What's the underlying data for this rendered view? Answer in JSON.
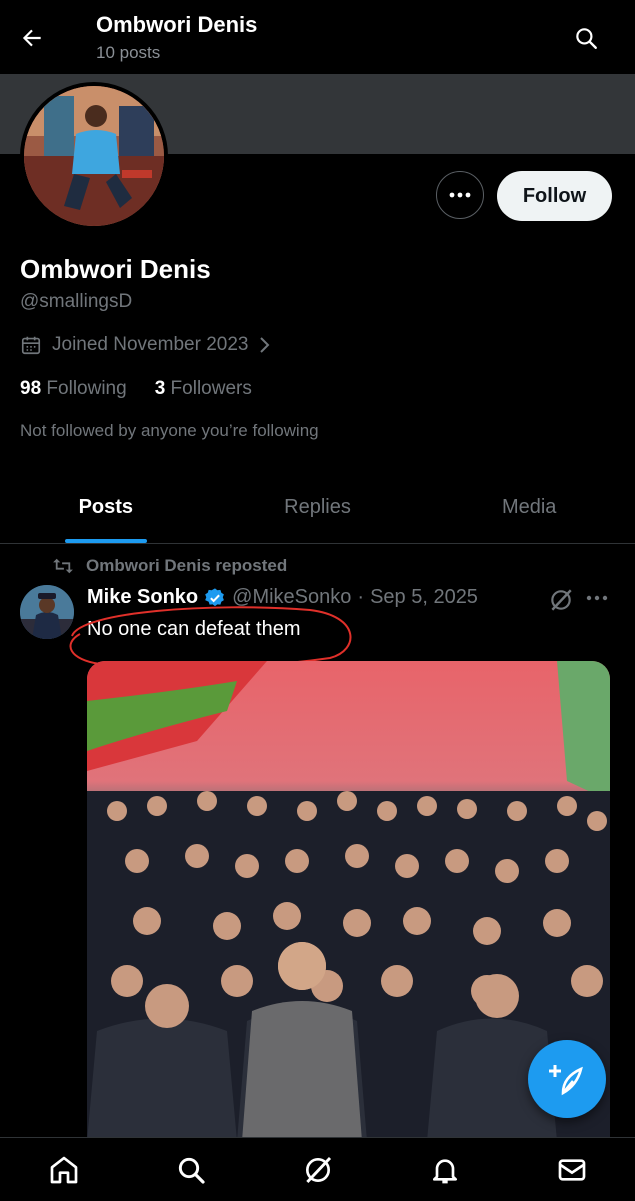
{
  "header": {
    "title": "Ombwori Denis",
    "subtitle": "10 posts"
  },
  "profile": {
    "name": "Ombwori Denis",
    "handle": "@smallingsD",
    "joined": "Joined November 2023",
    "following_count": "98",
    "following_label": "Following",
    "followers_count": "3",
    "followers_label": "Followers",
    "not_followed": "Not followed by anyone you’re following",
    "follow_label": "Follow"
  },
  "tabs": [
    {
      "label": "Posts",
      "active": true
    },
    {
      "label": "Replies",
      "active": false
    },
    {
      "label": "Media",
      "active": false
    }
  ],
  "post": {
    "repost_label": "Ombwori Denis reposted",
    "author_name": "Mike Sonko",
    "author_handle": "@MikeSonko",
    "separator": "·",
    "date": "Sep 5, 2025",
    "text": "No one can defeat them",
    "annotation_color": "#e0302a"
  },
  "colors": {
    "accent": "#1d9bf0",
    "background": "#000000",
    "banner": "#333639"
  },
  "icons": {
    "back": "back-arrow-icon",
    "search": "search-icon",
    "more": "more-dots-icon",
    "calendar": "calendar-icon",
    "repost": "repost-icon",
    "verified": "verified-badge-icon",
    "grok": "grok-icon",
    "compose": "compose-icon",
    "home": "home-icon",
    "explore": "search-icon",
    "notifications": "bell-icon",
    "messages": "mail-icon"
  }
}
